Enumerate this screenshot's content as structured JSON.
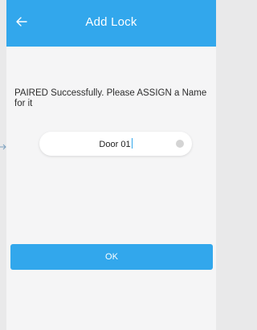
{
  "header": {
    "title": "Add Lock",
    "back_icon": "arrow-left-icon"
  },
  "message": "PAIRED Successfully. Please ASSIGN a Name for it",
  "lock_name": {
    "value": "Door 01",
    "clear_icon": "clear-icon"
  },
  "ok_label": "OK",
  "colors": {
    "accent": "#32a7ec",
    "background": "#f5f5f6",
    "text": "#2d2d2d"
  }
}
